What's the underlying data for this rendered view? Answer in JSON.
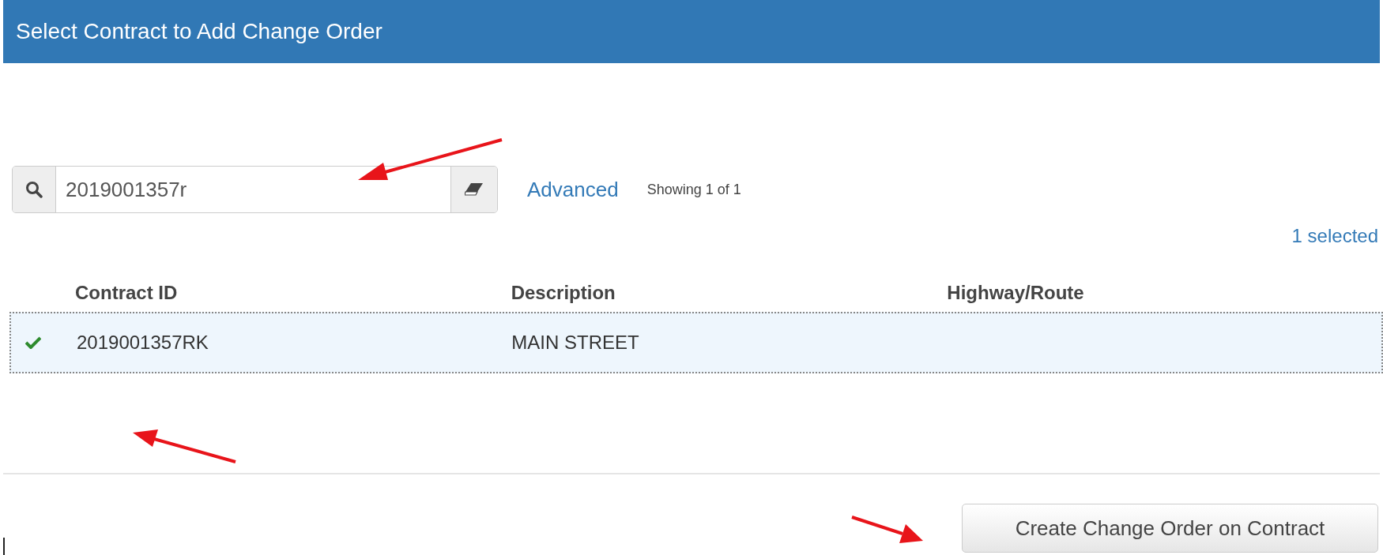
{
  "header": {
    "title": "Select Contract to Add Change Order"
  },
  "search": {
    "value": "2019001357r"
  },
  "advanced_link": "Advanced",
  "result_count": "Showing 1 of 1",
  "selection_count": "1 selected",
  "table": {
    "columns": [
      "Contract ID",
      "Description",
      "Highway/Route"
    ],
    "rows": [
      {
        "selected": true,
        "cells": [
          "2019001357RK",
          "MAIN STREET"
        ]
      }
    ]
  },
  "actions": [
    {
      "label": "Create Change Order on Contract"
    }
  ]
}
